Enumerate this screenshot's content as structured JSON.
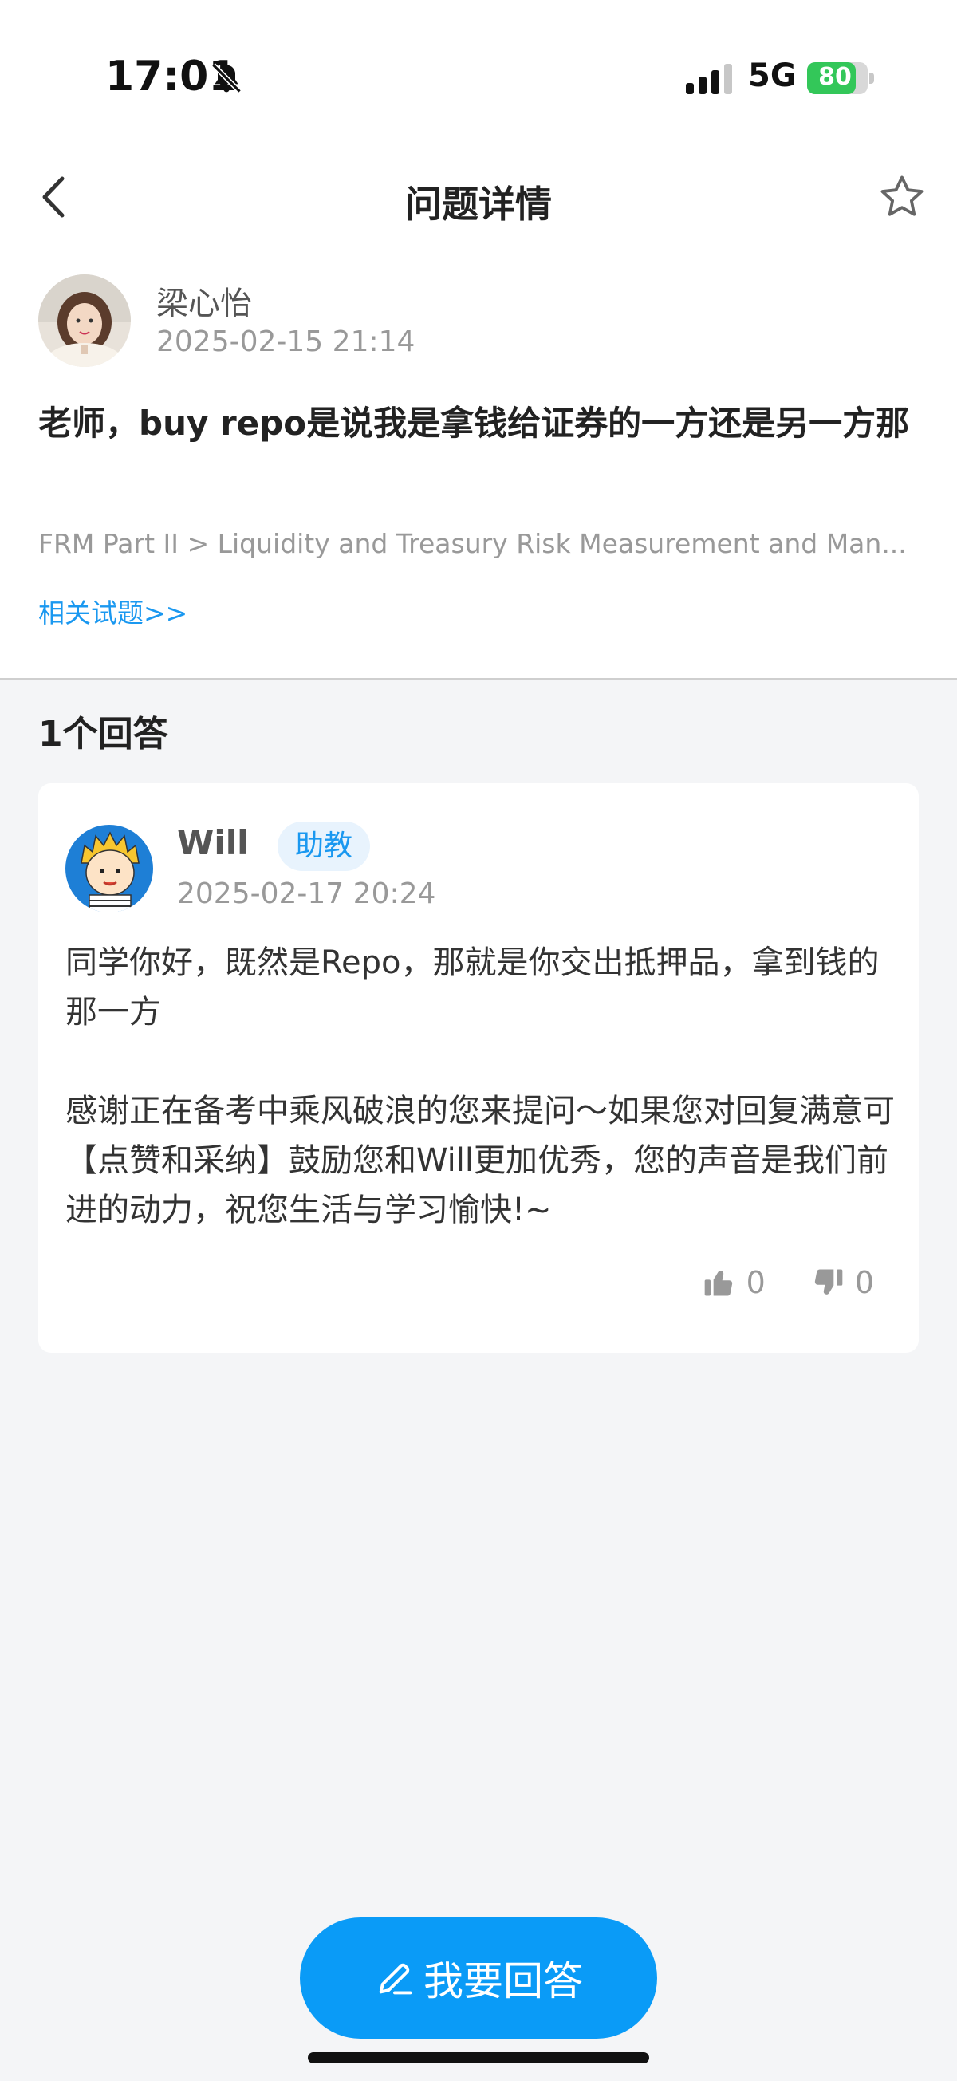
{
  "status_bar": {
    "time": "17:01",
    "network": "5G",
    "battery_percent": "80",
    "battery_level": 0.8,
    "battery_color": "#33c759"
  },
  "nav": {
    "title": "问题详情",
    "back_icon": "chevron-left-icon",
    "favorite_icon": "star-outline-icon"
  },
  "question": {
    "author": "梁心怡",
    "time": "2025-02-15 21:14",
    "text": "老师，buy repo是说我是拿钱给证券的一方还是另一方那",
    "path": "FRM Part II > Liquidity and Treasury Risk Measurement and Man...",
    "related_link": "相关试题>>"
  },
  "answers": {
    "count_label": "1个回答",
    "items": [
      {
        "author": "Will",
        "badge": "助教",
        "time": "2025-02-17 20:24",
        "paragraph1": "同学你好，既然是Repo，那就是你交出抵押品，拿到钱的那一方",
        "paragraph2": "感谢正在备考中乘风破浪的您来提问～如果您对回复满意可【点赞和采纳】鼓励您和Will更加优秀，您的声音是我们前进的动力，祝您生活与学习愉快!~",
        "likes": "0",
        "dislikes": "0"
      }
    ]
  },
  "bottom": {
    "answer_button_label": "我要回答",
    "accent_color": "#0a9bf7"
  }
}
